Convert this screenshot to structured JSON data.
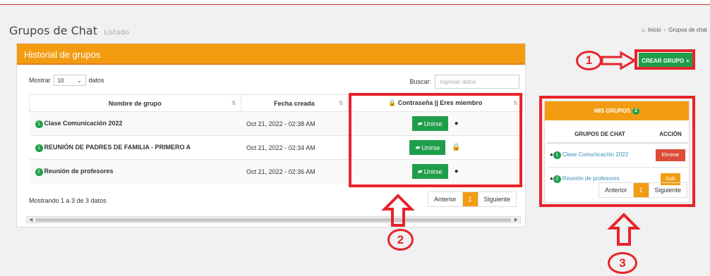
{
  "header": {
    "title": "Grupos de Chat",
    "subtitle": "Listado",
    "breadcrumb_home": "Inicio",
    "breadcrumb_current": "Grupos de chat"
  },
  "panel": {
    "title": "Historial de grupos",
    "create_button": "CREAR GRUPO",
    "show_label": "Mostrar",
    "show_value": "10",
    "show_suffix": "datos",
    "search_label": "Buscar:",
    "search_placeholder": "Ingresar datos",
    "columns": [
      "Nombre de grupo",
      "Fecha creada",
      "Contraseña || Eres miembro"
    ],
    "rows": [
      {
        "num": "1",
        "name": "Clase Comunicación 2022",
        "date": "Oct 21, 2022 - 02:38 AM",
        "button": "Unirse"
      },
      {
        "num": "1",
        "name": "REUNIÓN DE PADRES DE FAMILIA - PRIMERO A",
        "date": "Oct 21, 2022 - 02:34 AM",
        "button": "Unirse"
      },
      {
        "num": "2",
        "name": "Reunión de profesores",
        "date": "Oct 21, 2022 - 02:36 AM",
        "button": "Unirse"
      }
    ],
    "footer": "Mostrando 1 a 3 de 3 datos",
    "pager": {
      "prev": "Anterior",
      "page": "1",
      "next": "Siguiente"
    }
  },
  "mis_grupos": {
    "title": "MIS GRUPOS",
    "badge": "2",
    "col_chat": "GRUPOS DE CHAT",
    "col_action": "ACCIÓN",
    "rows": [
      {
        "num": "1",
        "name": "Clase Comunicación 2022",
        "action": "Eliminar"
      },
      {
        "num": "2",
        "name": "Reunión de profesores",
        "action": "Salir"
      }
    ],
    "pager": {
      "prev": "Anterior",
      "page": "1",
      "next": "Siguiente"
    }
  },
  "annotations": [
    "1",
    "2",
    "3"
  ]
}
